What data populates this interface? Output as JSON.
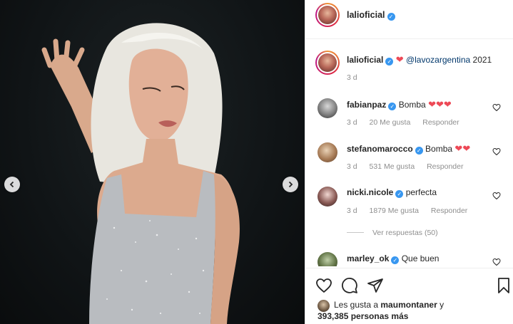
{
  "post": {
    "author": "lalioficial",
    "caption_mention": "@lavozargentina",
    "caption_text": "2021",
    "time": "3 d"
  },
  "comments": [
    {
      "user": "fabianpaz",
      "text": "Bomba",
      "hearts": "❤❤❤",
      "time": "3 d",
      "likes": "20 Me gusta",
      "reply": "Responder"
    },
    {
      "user": "stefanomarocco",
      "text": "Bomba",
      "hearts": "❤❤",
      "time": "3 d",
      "likes": "531 Me gusta",
      "reply": "Responder"
    },
    {
      "user": "nicki.nicole",
      "text": "perfecta",
      "hearts": "",
      "time": "3 d",
      "likes": "1879 Me gusta",
      "reply": "Responder"
    },
    {
      "user": "marley_ok",
      "text": "Que buen",
      "hearts": "",
      "time": "",
      "likes": "",
      "reply": ""
    }
  ],
  "view_replies": "Ver respuestas (50)",
  "likes_line": {
    "prefix": "Les gusta a",
    "user": "maumontaner",
    "suffix": "y",
    "count": "393,385 personas más"
  },
  "icons": {
    "like": "heart-icon",
    "comment": "comment-icon",
    "share": "share-icon",
    "save": "bookmark-icon",
    "prev": "chevron-left-icon",
    "next": "chevron-right-icon"
  },
  "colors": {
    "verified": "#3897f0",
    "heart": "#ed4956",
    "meta": "#8e8e8e",
    "link": "#00376b"
  }
}
